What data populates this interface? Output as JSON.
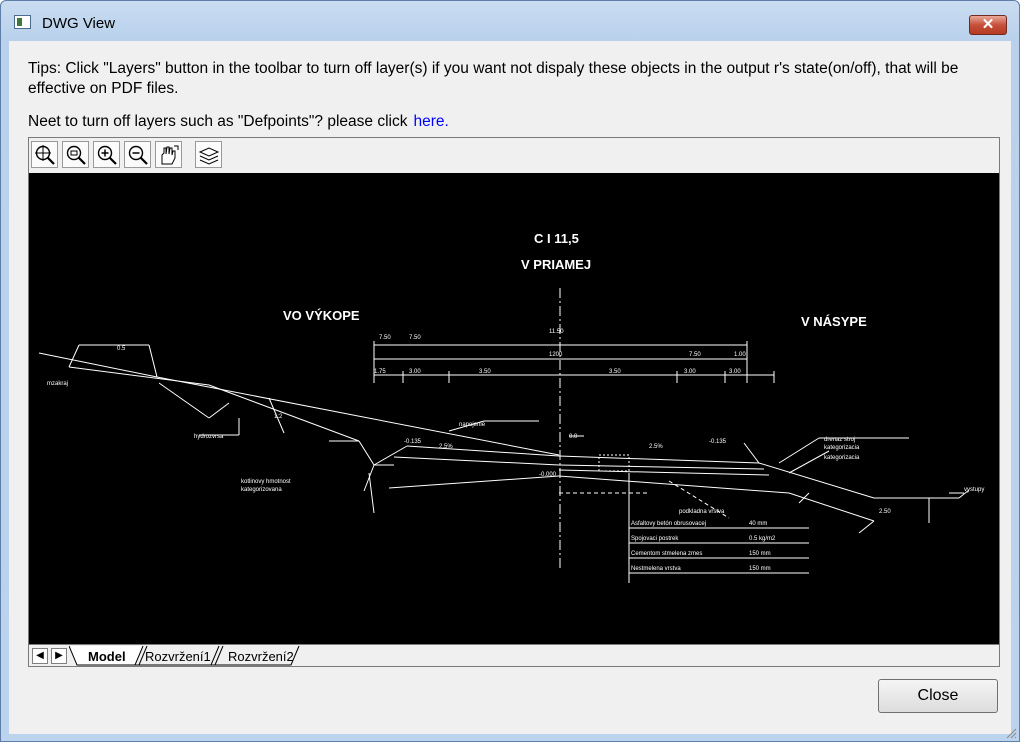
{
  "window": {
    "title": "DWG View",
    "close_glyph": "✕"
  },
  "tips": {
    "text": "Tips: Click \"Layers\" button in the toolbar to turn off layer(s) if you want not dispaly these objects in the output r's state(on/off), that will be effective on PDF files.",
    "need_text": "Neet to turn off layers such as \"Defpoints\"? please click",
    "link_text": "here."
  },
  "toolbar": {
    "buttons": [
      {
        "name": "zoom-extents-icon"
      },
      {
        "name": "zoom-window-icon"
      },
      {
        "name": "zoom-in-icon"
      },
      {
        "name": "zoom-out-icon"
      },
      {
        "name": "pan-hand-icon"
      },
      {
        "name": "layers-icon"
      }
    ]
  },
  "drawing": {
    "title_top": "C I 11,5",
    "title_sub": "V PRIAMEJ",
    "label_left": "VO VÝKOPE",
    "label_right": "V NÁSYPE"
  },
  "tabs": {
    "prev_glyph": "◀",
    "next_glyph": "▶",
    "items": [
      "Model",
      "Rozvržení1",
      "Rozvržení2"
    ],
    "active": "Model"
  },
  "buttons": {
    "close_label": "Close"
  }
}
